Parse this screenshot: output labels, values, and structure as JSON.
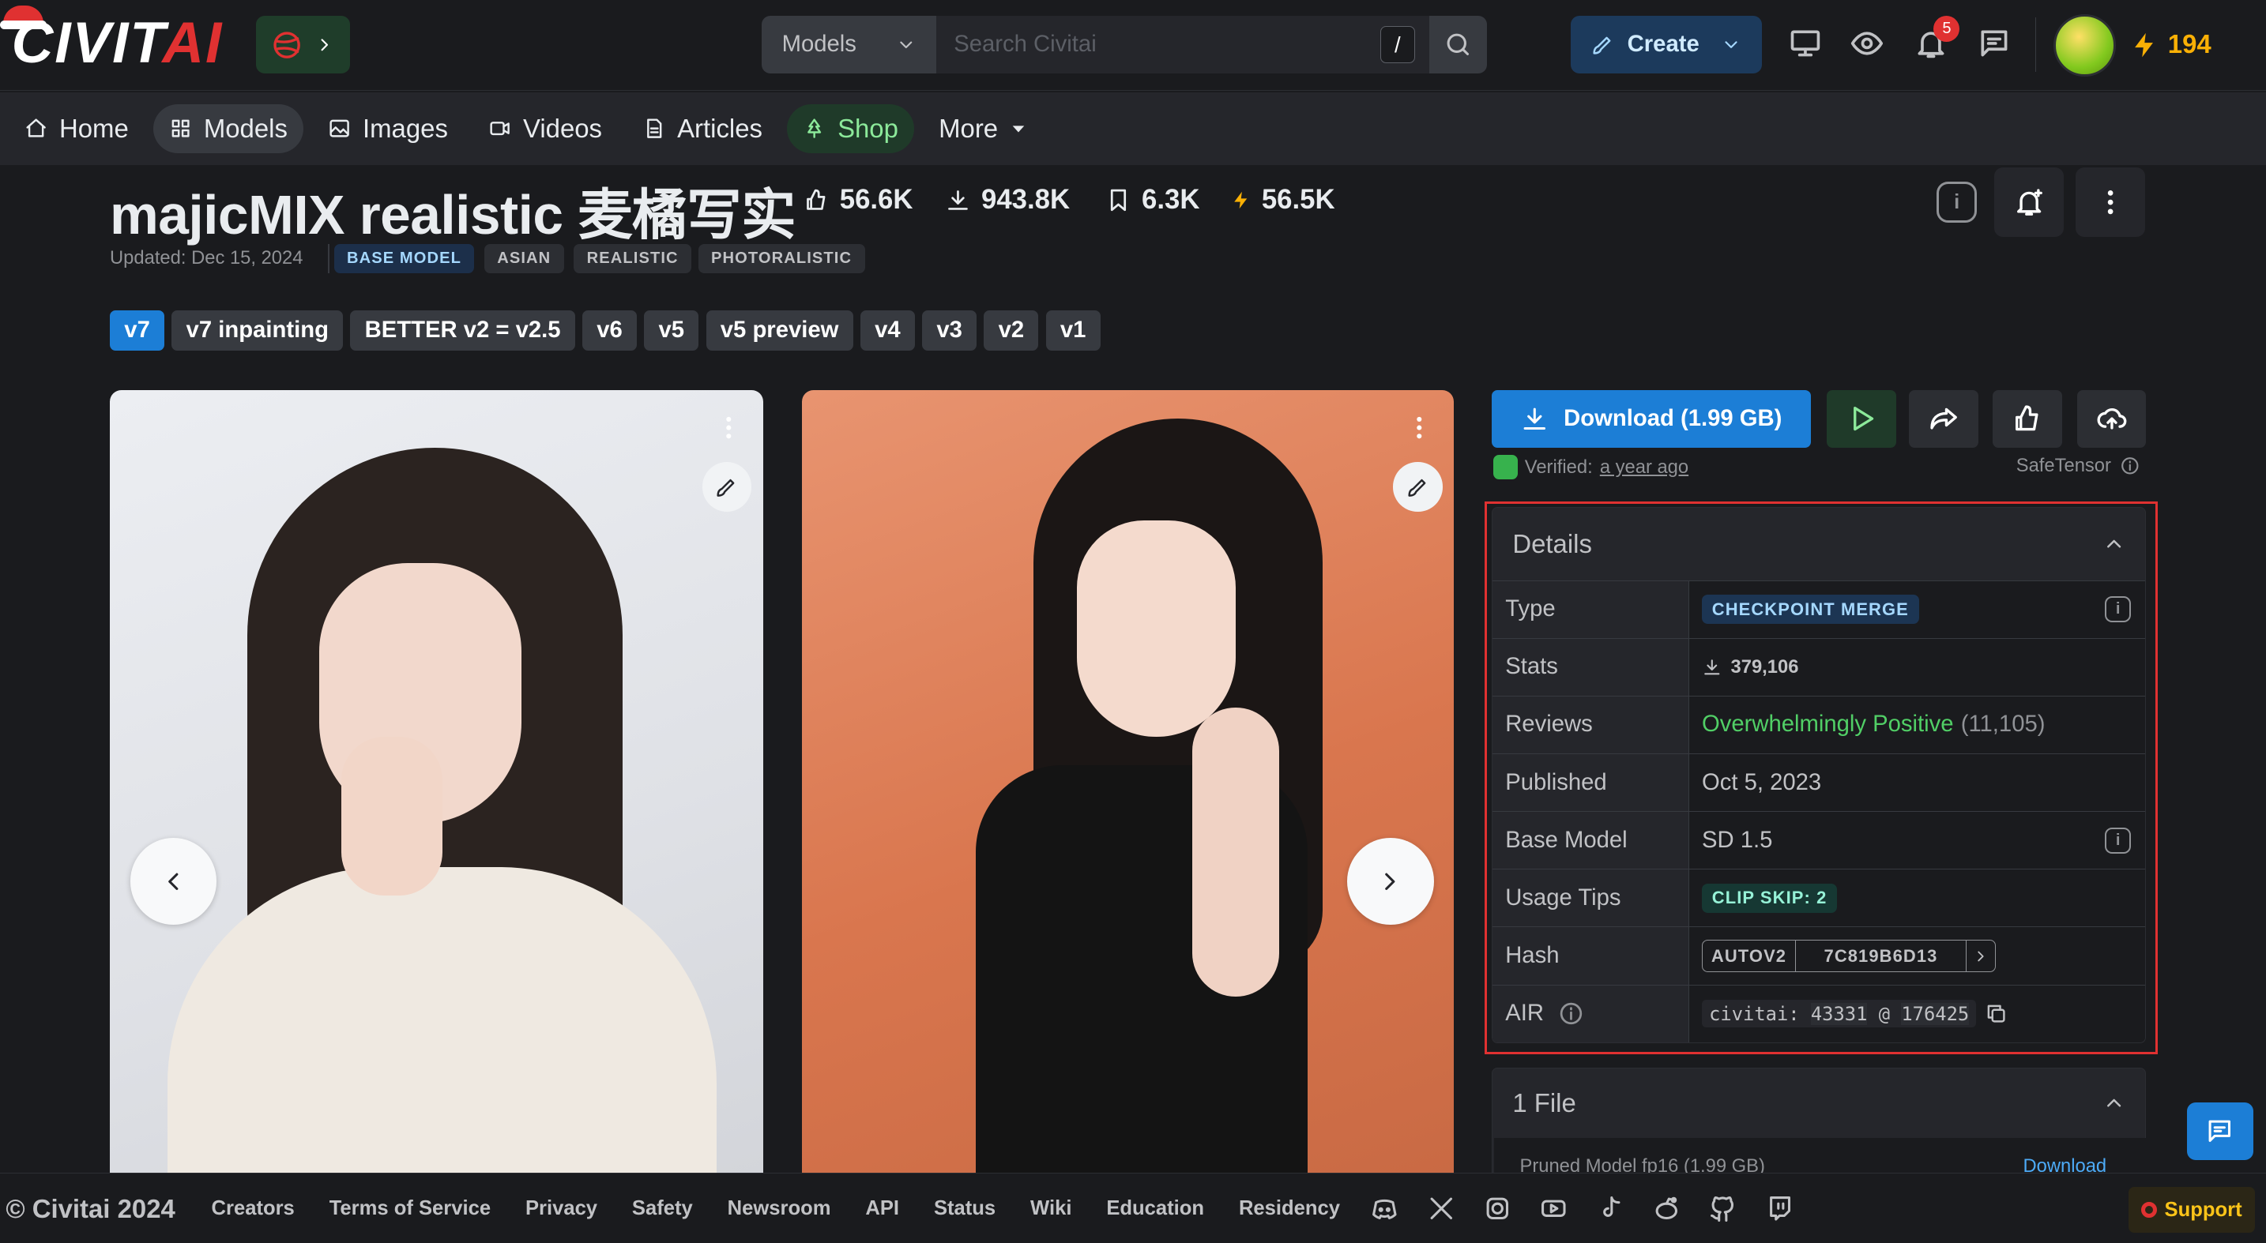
{
  "header": {
    "logo_main": "CIVIT",
    "logo_ai": "AI",
    "search_category": "Models",
    "search_placeholder": "Search Civitai",
    "search_shortcut": "/",
    "create_label": "Create",
    "notification_count": "5",
    "buzz_amount": "194"
  },
  "nav": {
    "items": [
      {
        "label": "Home",
        "icon": "home-icon"
      },
      {
        "label": "Models",
        "icon": "grid-icon",
        "active": true
      },
      {
        "label": "Images",
        "icon": "photo-icon"
      },
      {
        "label": "Videos",
        "icon": "video-icon"
      },
      {
        "label": "Articles",
        "icon": "file-icon"
      },
      {
        "label": "Shop",
        "icon": "tree-icon"
      },
      {
        "label": "More",
        "icon": "caret-down-icon"
      }
    ]
  },
  "model": {
    "title": "majicMIX realistic 麦橘写实",
    "likes": "56.6K",
    "downloads": "943.8K",
    "collects": "6.3K",
    "buzz": "56.5K",
    "updated": "Updated: Dec 15, 2024",
    "tags": [
      "BASE MODEL",
      "ASIAN",
      "REALISTIC",
      "PHOTORALISTIC"
    ],
    "versions": [
      "v7",
      "v7 inpainting",
      "BETTER v2 = v2.5",
      "v6",
      "v5",
      "v5 preview",
      "v4",
      "v3",
      "v2",
      "v1"
    ],
    "active_version": "v7"
  },
  "actions": {
    "download_label": "Download (1.99 GB)",
    "verified_label": "Verified:",
    "verified_time": "a year ago",
    "format": "SafeTensor"
  },
  "details": {
    "heading": "Details",
    "rows": {
      "type_key": "Type",
      "type_val": "CHECKPOINT MERGE",
      "stats_key": "Stats",
      "stats_val": "379,106",
      "reviews_key": "Reviews",
      "reviews_val": "Overwhelmingly Positive",
      "reviews_count": "(11,105)",
      "published_key": "Published",
      "published_val": "Oct 5, 2023",
      "base_key": "Base Model",
      "base_val": "SD 1.5",
      "tips_key": "Usage Tips",
      "tips_val": "CLIP SKIP: 2",
      "hash_key": "Hash",
      "hash_type": "AUTOV2",
      "hash_val": "7C819B6D13",
      "air_key": "AIR",
      "air_prefix": "civitai:",
      "air_model": "43331",
      "air_at": "@",
      "air_version": "176425"
    }
  },
  "files": {
    "heading": "1 File",
    "file_name": "Pruned Model fp16 (1.99 GB)",
    "file_action": "Download"
  },
  "footer": {
    "copyright": "© Civitai 2024",
    "links": [
      "Creators",
      "Terms of Service",
      "Privacy",
      "Safety",
      "Newsroom",
      "API",
      "Status",
      "Wiki",
      "Education",
      "Residency"
    ],
    "social": [
      "discord-icon",
      "x-icon",
      "instagram-icon",
      "youtube-icon",
      "tiktok-icon",
      "reddit-icon",
      "github-icon",
      "twitch-icon"
    ],
    "support_label": "Support"
  },
  "colors": {
    "accent": "#1c7ed6",
    "brand_red": "#e03131",
    "positive": "#51cf66",
    "buzz": "#fab005"
  }
}
